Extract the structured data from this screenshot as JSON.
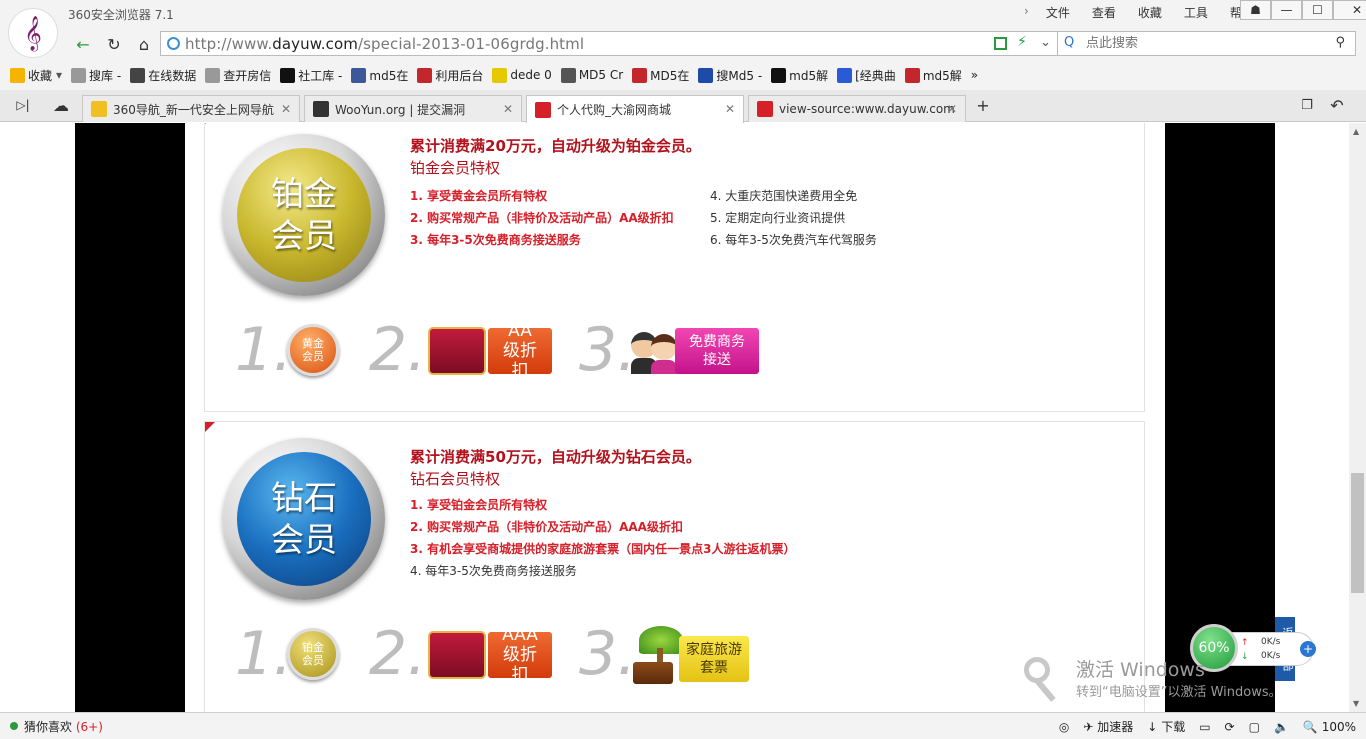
{
  "app": {
    "title": "360安全浏览器 7.1",
    "logo_glyph": "𝄞"
  },
  "menu": {
    "items": [
      "文件",
      "查看",
      "收藏",
      "工具",
      "帮助"
    ]
  },
  "window_controls": {
    "pin": "☗",
    "minimize": "—",
    "maximize": "☐",
    "close": "✕"
  },
  "address_bar": {
    "url_prefix": "http://www.",
    "url_domain": "dayuw.com",
    "url_path": "/special-2013-01-06grdg.html"
  },
  "search": {
    "placeholder": "点此搜索"
  },
  "bookmarks": [
    {
      "label": "收藏",
      "icon": "star-icon",
      "color": "#f4b400"
    },
    {
      "label": "搜库 -",
      "icon": "page-icon",
      "color": "#999999"
    },
    {
      "label": "在线数据",
      "icon": "xp-icon",
      "color": "#444444"
    },
    {
      "label": "查开房信",
      "icon": "page-icon",
      "color": "#999999"
    },
    {
      "label": "社工库 -",
      "icon": "pw-icon",
      "color": "#111111"
    },
    {
      "label": "md5在",
      "icon": "grid-icon",
      "color": "#3b5998"
    },
    {
      "label": "利用后台",
      "icon": "shield-icon",
      "color": "#c3272b"
    },
    {
      "label": "dede 0",
      "icon": "dede-icon",
      "color": "#e4c900"
    },
    {
      "label": "MD5 Cr",
      "icon": "md5-icon",
      "color": "#555555"
    },
    {
      "label": "MD5在",
      "icon": "md5-red-icon",
      "color": "#c3272b"
    },
    {
      "label": "搜Md5 -",
      "icon": "soso-icon",
      "color": "#1e4aa8"
    },
    {
      "label": "md5解",
      "icon": "x-icon",
      "color": "#111111"
    },
    {
      "label": "[经典曲",
      "icon": "paw-icon",
      "color": "#2a5bd7"
    },
    {
      "label": "md5解",
      "icon": "pmd5-icon",
      "color": "#c3272b"
    }
  ],
  "tabs": [
    {
      "title": "360导航_新一代安全上网导航",
      "icon": "360-icon",
      "color": "#f0c020"
    },
    {
      "title": "WooYun.org | 提交漏洞",
      "icon": "wooyun-icon",
      "color": "#333333"
    },
    {
      "title": "个人代购_大渝网商城",
      "icon": "dayuw-icon",
      "color": "#d5202a"
    },
    {
      "title": "view-source:www.dayuw.com",
      "icon": "dayuw-icon",
      "color": "#d5202a"
    }
  ],
  "page": {
    "platinum": {
      "medal_line1": "铂金",
      "medal_line2": "会员",
      "headline": "累计消费满20万元，自动升级为铂金会员。",
      "subhead": "铂金会员特权",
      "perks_left": [
        "1. 享受黄金会员所有特权",
        "2. 购买常规产品（非特价及活动产品）AA级折扣",
        "3. 每年3-5次免费商务接送服务"
      ],
      "perks_right": [
        "4. 大重庆范围快递费用全免",
        "5. 定期定向行业资讯提供",
        "6. 每年3-5次免费汽车代驾服务"
      ],
      "step_numbers": [
        "1.",
        "2.",
        "3."
      ],
      "step1_coin": "黄金会员",
      "step2_badge": "AA级折扣",
      "step3_badge": "免费商务接送"
    },
    "diamond": {
      "medal_line1": "钻石",
      "medal_line2": "会员",
      "headline": "累计消费满50万元，自动升级为钻石会员。",
      "subhead": "钻石会员特权",
      "perks_left": [
        "1. 享受铂金会员所有特权",
        "2. 购买常规产品（非特价及活动产品）AAA级折扣",
        "3. 有机会享受商城提供的家庭旅游套票（国内任一景点3人游往返机票）",
        "4. 每年3-5次免费商务接送服务"
      ],
      "step_numbers": [
        "1.",
        "2.",
        "3."
      ],
      "step1_coin": "铂金会员",
      "step2_badge": "AAA级折扣",
      "step3_badge": "家庭旅游套票"
    }
  },
  "speed_widget": {
    "percent": "60%",
    "up": "0K/s",
    "down": "0K/s"
  },
  "side_tab": {
    "label": "返回顶部"
  },
  "watermark": {
    "line1": "激活 Windows",
    "line2": "转到“电脑设置”以激活 Windows。"
  },
  "statusbar": {
    "guess_label": "猜你喜欢",
    "guess_count": "(6+)",
    "accelerator": "加速器",
    "download": "下载",
    "zoom": "100%"
  }
}
